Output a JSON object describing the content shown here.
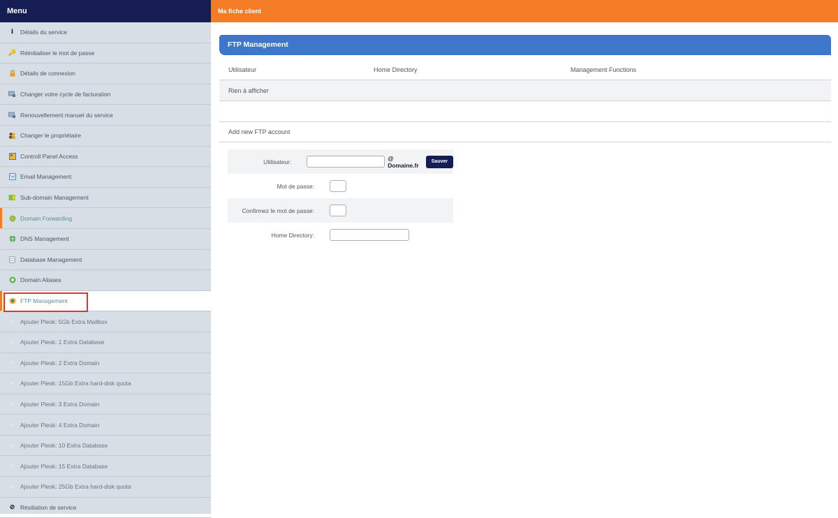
{
  "sidebar": {
    "title": "Menu",
    "items": [
      {
        "label": "Détails du service",
        "icon": "info-icon"
      },
      {
        "label": "Réinitialiser le mot de passe",
        "icon": "key-icon"
      },
      {
        "label": "Détails de connexion",
        "icon": "lock-icon"
      },
      {
        "label": "Changer votre cycle de facturation",
        "icon": "billing-icon"
      },
      {
        "label": "Renouvellement manuel du service",
        "icon": "billing-icon"
      },
      {
        "label": "Changer le propriétaire",
        "icon": "users-icon"
      },
      {
        "label": "Controll Panel Access",
        "icon": "panel-icon"
      },
      {
        "label": "Email Management",
        "icon": "mail-icon"
      },
      {
        "label": "Sub-domain Management",
        "icon": "subdomain-icon"
      },
      {
        "label": "Domain Forwarding",
        "icon": "forward-icon"
      },
      {
        "label": "DNS Management",
        "icon": "dns-icon"
      },
      {
        "label": "Database Management",
        "icon": "database-icon"
      },
      {
        "label": "Domain Aliases",
        "icon": "alias-icon"
      },
      {
        "label": "FTP Management",
        "icon": "ftp-icon"
      },
      {
        "label": "Ajouter Plesk: 5Gb Extra Mailbox",
        "icon": "circle-icon"
      },
      {
        "label": "Ajouter Plesk: 1 Extra Database",
        "icon": "circle-icon"
      },
      {
        "label": "Ajouter Plesk: 2 Extra Domain",
        "icon": "circle-icon"
      },
      {
        "label": "Ajouter Plesk: 15Gb Extra hard-disk quota",
        "icon": "circle-icon"
      },
      {
        "label": "Ajouter Plesk: 3 Extra Domain",
        "icon": "circle-icon"
      },
      {
        "label": "Ajouter Plesk: 4 Extra Domain",
        "icon": "circle-icon"
      },
      {
        "label": "Ajouter Plesk: 10 Extra Database",
        "icon": "circle-icon"
      },
      {
        "label": "Ajouter Plesk: 15 Extra Database",
        "icon": "circle-icon"
      },
      {
        "label": "Ajouter Plesk: 25Gb Extra hard-disk quota",
        "icon": "circle-icon"
      },
      {
        "label": "Résiliation de service",
        "icon": "cancel-icon"
      }
    ]
  },
  "topbar": {
    "title": "Ma fiche client"
  },
  "panel": {
    "title": "FTP Management",
    "columns": [
      "Utilisateur",
      "Home Directory",
      "Management Functions"
    ],
    "empty_text": "Rien à afficher",
    "add_title": "Add new FTP account"
  },
  "form": {
    "user_label": "Utilisateur:",
    "user_value": "",
    "domain_suffix": "@ Domaine.fr",
    "save_label": "Sauver",
    "password_label": "Mot de passe:",
    "confirm_label": "Confirmez le mot de passe:",
    "home_label": "Home Directory:",
    "home_value": ""
  },
  "colors": {
    "navy": "#151d52",
    "orange": "#f47c27",
    "blue": "#3e77c9",
    "highlight": "#e0342c"
  }
}
